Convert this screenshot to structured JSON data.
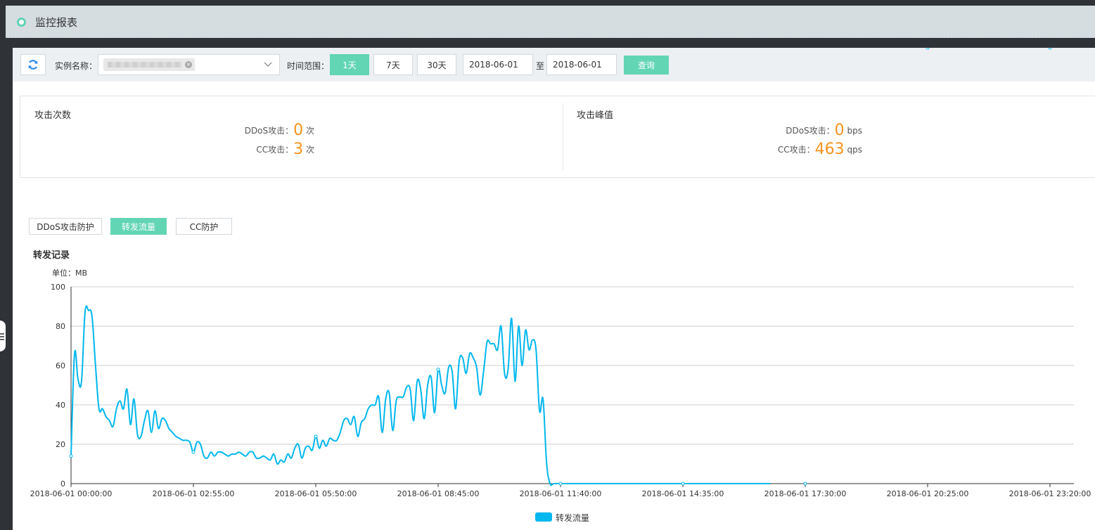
{
  "header": {
    "title": "监控报表"
  },
  "toolbar": {
    "instance_label": "实例名称：",
    "time_range_label": "时间范围：",
    "range_options": [
      "1天",
      "7天",
      "30天"
    ],
    "active_range": "1天",
    "date_from": "2018-06-01",
    "date_sep": "至",
    "date_to": "2018-06-01",
    "query_label": "查询"
  },
  "attack_count": {
    "title": "攻击次数",
    "ddos_label": "DDoS攻击：",
    "ddos_value": "0",
    "ddos_unit": "次",
    "cc_label": "CC攻击：",
    "cc_value": "3",
    "cc_unit": "次"
  },
  "attack_peak": {
    "title": "攻击峰值",
    "ddos_label": "DDoS攻击：",
    "ddos_value": "0",
    "ddos_unit": "bps",
    "cc_label": "CC攻击：",
    "cc_value": "463",
    "cc_unit": "qps"
  },
  "tabs": [
    {
      "label": "DDoS攻击防护",
      "active": false
    },
    {
      "label": "转发流量",
      "active": true
    },
    {
      "label": "CC防护",
      "active": false
    }
  ],
  "chart_heading": "转发记录",
  "colors": {
    "accent": "#62d5b4",
    "series": "#00b7ee",
    "number": "#f7931e"
  },
  "chart_data": {
    "type": "line",
    "ylabel": "单位：MB",
    "ylim": [
      0,
      100
    ],
    "yticks": [
      "0",
      "20",
      "40",
      "60",
      "80",
      "100"
    ],
    "grid": true,
    "legend_position": "bottom-center",
    "xticks": [
      "2018-06-01 00:00:00",
      "2018-06-01 02:55:00",
      "2018-06-01 05:50:00",
      "2018-06-01 08:45:00",
      "2018-06-01 11:40:00",
      "2018-06-01 14:35:00",
      "2018-06-01 17:30:00",
      "2018-06-01 20:25:00",
      "2018-06-01 23:20:00"
    ],
    "x_range_minutes": [
      0,
      1435
    ],
    "series": [
      {
        "name": "转发流量",
        "x_minutes": [
          0,
          5,
          10,
          15,
          20,
          25,
          30,
          35,
          40,
          45,
          50,
          55,
          60,
          65,
          70,
          75,
          80,
          85,
          90,
          95,
          100,
          105,
          110,
          115,
          120,
          125,
          130,
          135,
          140,
          145,
          150,
          155,
          160,
          165,
          170,
          175,
          180,
          185,
          190,
          195,
          200,
          205,
          210,
          215,
          220,
          225,
          230,
          235,
          240,
          245,
          250,
          255,
          260,
          265,
          270,
          275,
          280,
          285,
          290,
          295,
          300,
          305,
          310,
          315,
          320,
          325,
          330,
          335,
          340,
          345,
          350,
          355,
          360,
          365,
          370,
          375,
          380,
          385,
          390,
          395,
          400,
          405,
          410,
          415,
          420,
          425,
          430,
          435,
          440,
          445,
          450,
          455,
          460,
          465,
          470,
          475,
          480,
          485,
          490,
          495,
          500,
          505,
          510,
          515,
          520,
          525,
          530,
          535,
          540,
          545,
          550,
          555,
          560,
          565,
          570,
          575,
          580,
          585,
          590,
          595,
          600,
          605,
          610,
          615,
          620,
          625,
          630,
          635,
          640,
          645,
          650,
          655,
          660,
          665,
          670,
          675,
          680,
          685,
          690,
          695,
          700,
          720,
          800,
          900,
          1000,
          1100,
          1200,
          1300,
          1435
        ],
        "values": [
          14,
          66,
          53,
          52,
          87,
          88,
          85,
          60,
          38,
          38,
          34,
          32,
          29,
          38,
          42,
          38,
          48,
          30,
          43,
          25,
          24,
          32,
          37,
          26,
          37,
          28,
          33,
          32,
          28,
          26,
          24,
          23,
          22,
          22,
          21,
          16,
          21,
          20,
          14,
          13,
          16,
          14,
          16,
          16,
          15,
          14,
          15,
          15,
          16,
          15,
          14,
          16,
          16,
          13,
          13,
          14,
          13,
          12,
          15,
          10,
          12,
          11,
          15,
          13,
          18,
          20,
          13,
          18,
          19,
          17,
          24,
          18,
          22,
          19,
          23,
          22,
          22,
          26,
          32,
          33,
          30,
          34,
          24,
          31,
          33,
          38,
          40,
          40,
          44,
          26,
          43,
          46,
          27,
          42,
          44,
          44,
          49,
          48,
          32,
          52,
          48,
          33,
          50,
          54,
          36,
          58,
          50,
          46,
          59,
          57,
          38,
          62,
          64,
          56,
          66,
          64,
          59,
          45,
          57,
          72,
          71,
          71,
          68,
          80,
          56,
          58,
          84,
          52,
          80,
          60,
          78,
          68,
          73,
          68,
          37,
          43,
          11,
          0,
          0,
          0,
          0,
          0,
          0,
          0,
          0,
          0
        ]
      }
    ],
    "markers_minutes": [
      0,
      175,
      350,
      525,
      700,
      875,
      1050,
      1225,
      1400
    ]
  }
}
